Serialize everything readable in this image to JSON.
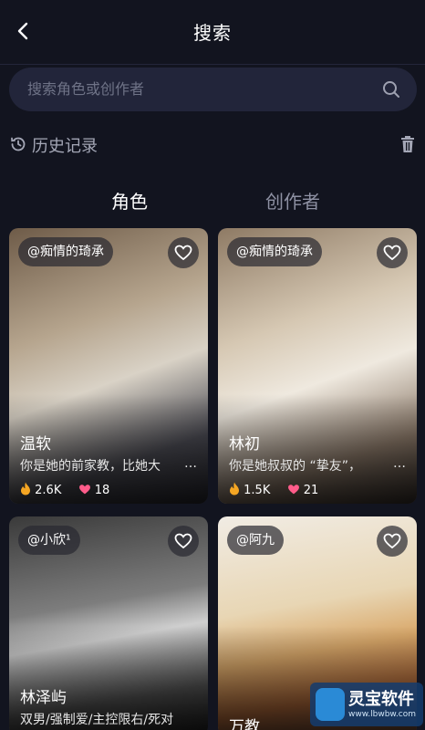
{
  "header": {
    "title": "搜索"
  },
  "search": {
    "placeholder": "搜索角色或创作者"
  },
  "history": {
    "label": "历史记录"
  },
  "tabs": [
    {
      "label": "角色",
      "active": true
    },
    {
      "label": "创作者",
      "active": false
    }
  ],
  "cards": [
    {
      "creator": "@痴情的琦承",
      "name": "温软",
      "desc": "你是她的前家教，比她大",
      "more": "…",
      "fires": "2.6K",
      "hearts": "18"
    },
    {
      "creator": "@痴情的琦承",
      "name": "林初",
      "desc": "你是她叔叔的 “挚友”，",
      "more": "…",
      "fires": "1.5K",
      "hearts": "21"
    },
    {
      "creator": "@小欣¹",
      "name": "林泽屿",
      "desc": "双男/强制爱/主控限右/死对"
    },
    {
      "creator": "@阿九",
      "name": "万教"
    }
  ],
  "watermark": {
    "text": "灵宝软件",
    "url": "www.lbwbw.com"
  },
  "colors": {
    "background": "#12141f",
    "search_bg": "#22253a",
    "tab_inactive": "#8e91a3",
    "fire": "#f5a623",
    "heart": "#ff5c8a"
  }
}
